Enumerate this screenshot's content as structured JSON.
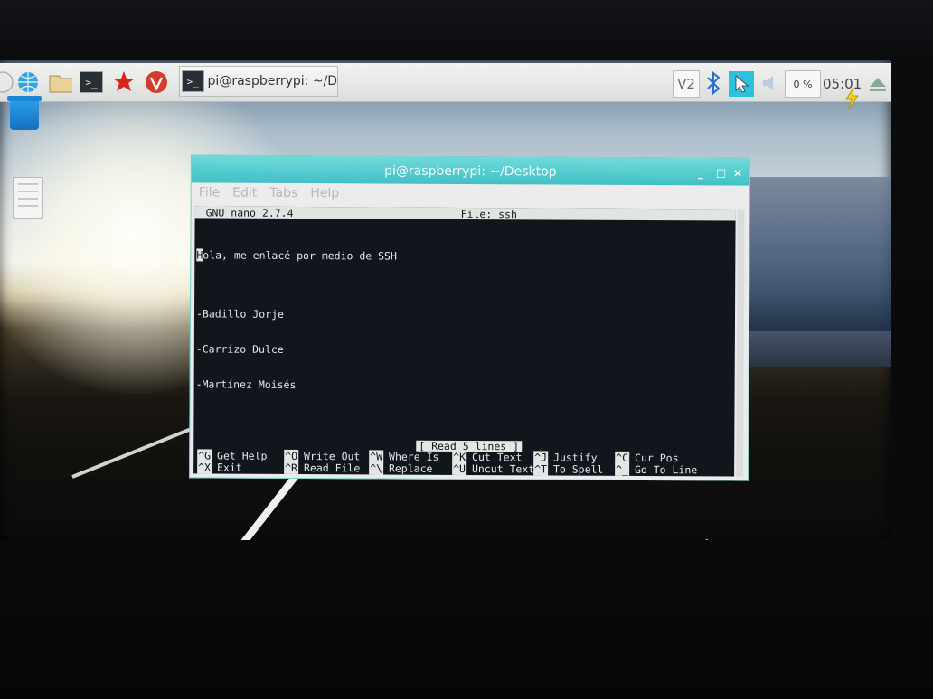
{
  "taskbar": {
    "task_button_label": "pi@raspberrypi: ~/De...",
    "term_icon_glyph": ">_",
    "vnc_label": "V2",
    "cpu_usage": "0 %",
    "clock": "05:01"
  },
  "window": {
    "title": "pi@raspberrypi: ~/Desktop",
    "menu": [
      "File",
      "Edit",
      "Tabs",
      "Help"
    ],
    "controls": [
      "_",
      "□",
      "×"
    ]
  },
  "nano": {
    "version": "GNU nano 2.7.4",
    "file": "File: ssh",
    "lines": [
      "Hola, me enlacé por medio de SSH",
      "",
      "-Badillo Jorje",
      "-Carrizo Dulce",
      "-Martínez Moisés"
    ],
    "status": "[ Read 5 lines ]",
    "shortcuts": [
      {
        "key": "^G",
        "label": "Get Help"
      },
      {
        "key": "^X",
        "label": "Exit"
      },
      {
        "key": "^O",
        "label": "Write Out"
      },
      {
        "key": "^R",
        "label": "Read File"
      },
      {
        "key": "^W",
        "label": "Where Is"
      },
      {
        "key": "^\\",
        "label": "Replace"
      },
      {
        "key": "^K",
        "label": "Cut Text"
      },
      {
        "key": "^U",
        "label": "Uncut Text"
      },
      {
        "key": "^J",
        "label": "Justify"
      },
      {
        "key": "^T",
        "label": "To Spell"
      },
      {
        "key": "^C",
        "label": "Cur Pos"
      },
      {
        "key": "^_",
        "label": "Go To Line"
      }
    ]
  },
  "icons": {
    "taskbar": [
      "menu-icon",
      "web-browser-icon",
      "file-manager-icon",
      "terminal-icon",
      "mathematica-icon",
      "wolfram-icon"
    ],
    "tray": [
      "vnc-icon",
      "bluetooth-icon",
      "network-icon",
      "volume-icon",
      "eject-icon"
    ]
  },
  "colors": {
    "titlebar": "#41c0c6",
    "terminal_bg": "#10161c"
  }
}
